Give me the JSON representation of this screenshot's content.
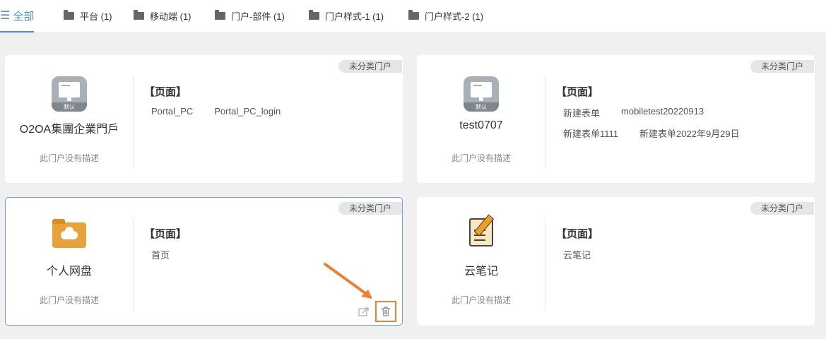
{
  "tabs": [
    {
      "label": "全部",
      "active": true
    },
    {
      "label": "平台 (1)"
    },
    {
      "label": "移动端 (1)"
    },
    {
      "label": "门户-部件 (1)"
    },
    {
      "label": "门户样式-1 (1)"
    },
    {
      "label": "门户样式-2 (1)"
    }
  ],
  "cards": [
    {
      "badge": "未分类门户",
      "icon": "monitor-default-icon",
      "icon_label": "默认",
      "name": "O2OA集團企業門戶",
      "desc": "此门户没有描述",
      "section": "【页面】",
      "pages": [
        "Portal_PC",
        "Portal_PC_login"
      ]
    },
    {
      "badge": "未分类门户",
      "icon": "monitor-default-icon",
      "icon_label": "默认",
      "name": "test0707",
      "desc": "此门户没有描述",
      "section": "【页面】",
      "pages": [
        "新建表单",
        "mobiletest20220913",
        "新建表单1111",
        "新建表单2022年9月29日"
      ]
    },
    {
      "badge": "未分类门户",
      "icon": "cloud-folder-icon",
      "name": "个人网盘",
      "desc": "此门户没有描述",
      "section": "【页面】",
      "pages": [
        "首页"
      ]
    },
    {
      "badge": "未分类门户",
      "icon": "note-pencil-icon",
      "name": "云笔记",
      "desc": "此门户没有描述",
      "section": "【页面】",
      "pages": [
        "云笔记"
      ]
    }
  ],
  "colors": {
    "accent": "#4a90e2",
    "highlight_border": "#6fa0e0",
    "annotation": "#f08030"
  }
}
